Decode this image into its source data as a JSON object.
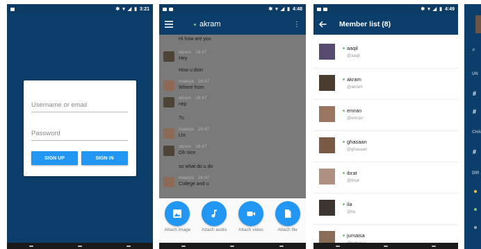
{
  "status": {
    "time_login": "3:21",
    "time_chat": "4:48",
    "time_members": "4:49"
  },
  "login": {
    "username_placeholder": "Username or email",
    "password_placeholder": "Password",
    "signup_label": "SIGN UP",
    "signin_label": "SIGN IN"
  },
  "chat": {
    "title": "akram",
    "messages": [
      {
        "text": "Hi how are you"
      },
      {
        "user": "akram",
        "time": "16:47",
        "text": "Hey"
      },
      {
        "text": "How u doin"
      },
      {
        "user": "maarya",
        "time": "16:47",
        "text": "Where from"
      },
      {
        "user": "akram",
        "time": "16:47",
        "text": "nep"
      },
      {
        "text": "?u"
      },
      {
        "user": "maarya",
        "time": "16:47",
        "text": "Lhr"
      },
      {
        "user": "akram",
        "time": "16:47",
        "text": "Oh nice"
      },
      {
        "text": "so what do u do"
      },
      {
        "user": "maarya",
        "time": "16:47",
        "text": "College and u"
      }
    ],
    "attachments": [
      {
        "label": "Attach image",
        "icon": "image-icon"
      },
      {
        "label": "Attach audio",
        "icon": "music-note-icon"
      },
      {
        "label": "Attach video",
        "icon": "video-camera-icon"
      },
      {
        "label": "Attach file",
        "icon": "file-icon"
      }
    ]
  },
  "members": {
    "title": "Member list (8)",
    "items": [
      {
        "name": "aaqil",
        "handle": "@aaqil"
      },
      {
        "name": "akram",
        "handle": "@akram"
      },
      {
        "name": "emran",
        "handle": "@emran"
      },
      {
        "name": "ghasaan",
        "handle": "@ghasaan"
      },
      {
        "name": "ibrat",
        "handle": "@ibrat"
      },
      {
        "name": "ila",
        "handle": "@ila"
      },
      {
        "name": "jumaisa",
        "handle": "@jumaisa"
      }
    ]
  },
  "drawer": {
    "section_unread": "UN",
    "section_channels": "CHA",
    "section_direct": "DIR"
  },
  "colors": {
    "primary": "#0b3e6a",
    "accent": "#2196f3",
    "online": "#7bc67b"
  }
}
